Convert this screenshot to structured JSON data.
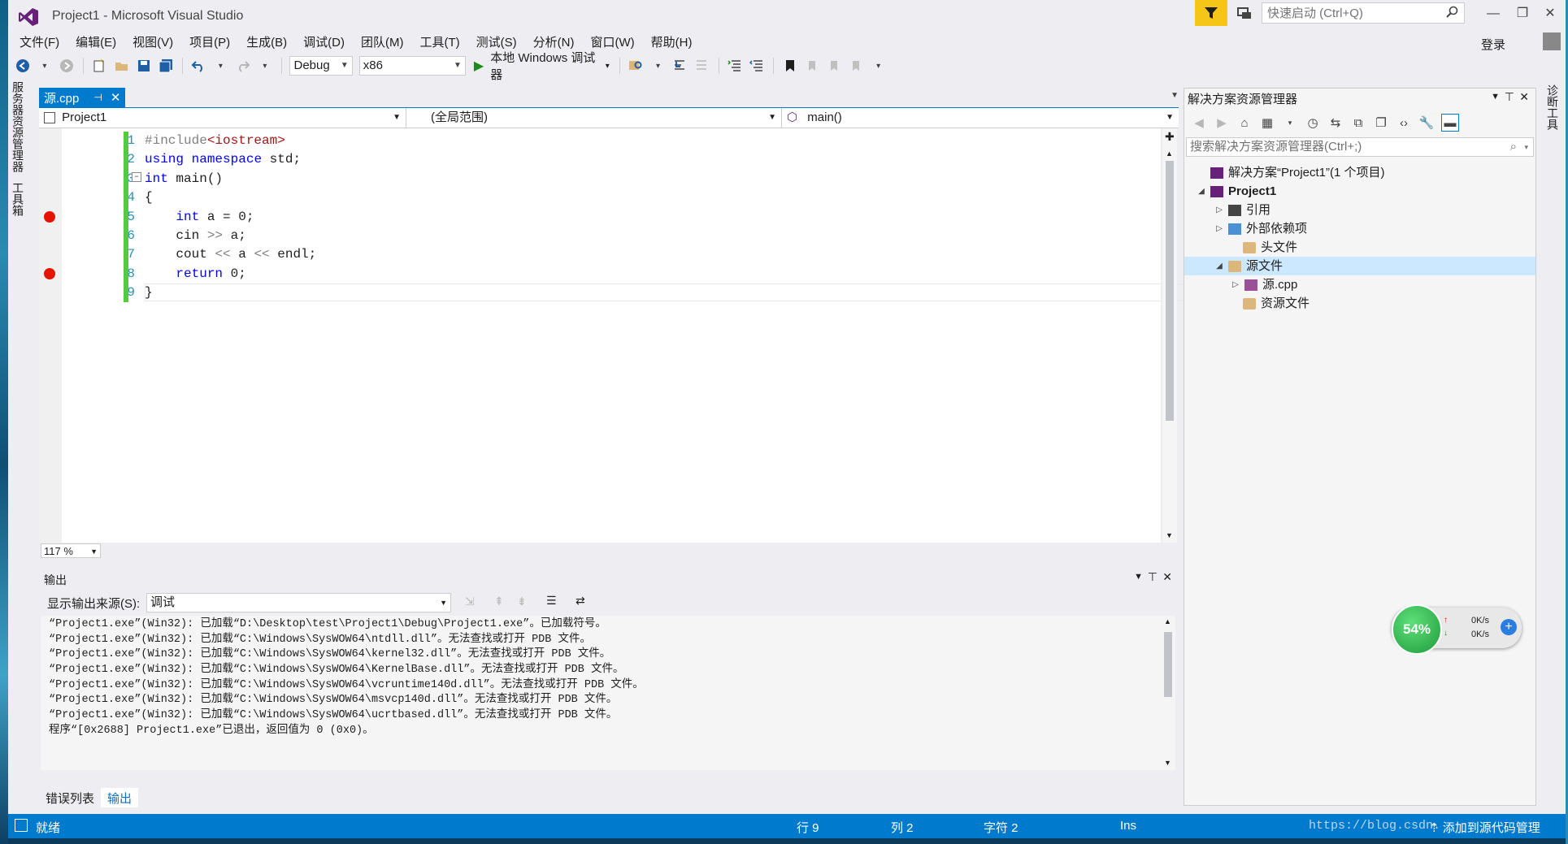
{
  "window": {
    "title": "Project1 - Microsoft Visual Studio",
    "quick_launch_placeholder": "快速启动 (Ctrl+Q)",
    "sign_in": "登录",
    "minimize": "—",
    "restore": "❐",
    "close": "✕"
  },
  "menu": [
    "文件(F)",
    "编辑(E)",
    "视图(V)",
    "项目(P)",
    "生成(B)",
    "调试(D)",
    "团队(M)",
    "工具(T)",
    "测试(S)",
    "分析(N)",
    "窗口(W)",
    "帮助(H)"
  ],
  "toolbar": {
    "configuration": "Debug",
    "platform": "x86",
    "run_label": "本地 Windows 调试器"
  },
  "left_vtabs": [
    "服务器资源管理器",
    "工具箱"
  ],
  "right_vtab": "诊断工具",
  "editor": {
    "tab_label": "源.cpp",
    "nav_project": "Project1",
    "nav_scope": "(全局范围)",
    "nav_member": "main()",
    "line_numbers": [
      "1",
      "2",
      "3",
      "4",
      "5",
      "6",
      "7",
      "8",
      "9"
    ],
    "code": [
      [
        {
          "t": "#include",
          "c": "pp"
        },
        {
          "t": "<iostream>",
          "c": "st"
        }
      ],
      [
        {
          "t": "using",
          "c": "kw"
        },
        {
          "t": " ",
          "c": ""
        },
        {
          "t": "namespace",
          "c": "kw"
        },
        {
          "t": " std;",
          "c": ""
        }
      ],
      [
        {
          "t": "int",
          "c": "kw"
        },
        {
          "t": " main()",
          "c": ""
        }
      ],
      [
        {
          "t": "{",
          "c": ""
        }
      ],
      [
        {
          "t": "    ",
          "c": ""
        },
        {
          "t": "int",
          "c": "kw"
        },
        {
          "t": " a = 0;",
          "c": ""
        }
      ],
      [
        {
          "t": "    cin ",
          "c": ""
        },
        {
          "t": ">>",
          "c": "op"
        },
        {
          "t": " a;",
          "c": ""
        }
      ],
      [
        {
          "t": "    cout ",
          "c": ""
        },
        {
          "t": "<<",
          "c": "op"
        },
        {
          "t": " a ",
          "c": ""
        },
        {
          "t": "<<",
          "c": "op"
        },
        {
          "t": " endl;",
          "c": ""
        }
      ],
      [
        {
          "t": "    ",
          "c": ""
        },
        {
          "t": "return",
          "c": "kw"
        },
        {
          "t": " 0;",
          "c": ""
        }
      ],
      [
        {
          "t": "}",
          "c": ""
        }
      ]
    ],
    "breakpoint_lines": [
      5,
      8
    ],
    "zoom": "117 %"
  },
  "output": {
    "title": "输出",
    "source_label": "显示输出来源(S):",
    "source_value": "调试",
    "lines": [
      "“Project1.exe”(Win32): 已加载“D:\\Desktop\\test\\Project1\\Debug\\Project1.exe”。已加载符号。",
      "“Project1.exe”(Win32): 已加载“C:\\Windows\\SysWOW64\\ntdll.dll”。无法查找或打开 PDB 文件。",
      "“Project1.exe”(Win32): 已加载“C:\\Windows\\SysWOW64\\kernel32.dll”。无法查找或打开 PDB 文件。",
      "“Project1.exe”(Win32): 已加载“C:\\Windows\\SysWOW64\\KernelBase.dll”。无法查找或打开 PDB 文件。",
      "“Project1.exe”(Win32): 已加载“C:\\Windows\\SysWOW64\\vcruntime140d.dll”。无法查找或打开 PDB 文件。",
      "“Project1.exe”(Win32): 已加载“C:\\Windows\\SysWOW64\\msvcp140d.dll”。无法查找或打开 PDB 文件。",
      "“Project1.exe”(Win32): 已加载“C:\\Windows\\SysWOW64\\ucrtbased.dll”。无法查找或打开 PDB 文件。",
      "程序“[0x2688] Project1.exe”已退出，返回值为 0 (0x0)。"
    ],
    "bottom_tabs": [
      "错误列表",
      "输出"
    ]
  },
  "solution_explorer": {
    "title": "解决方案资源管理器",
    "search_placeholder": "搜索解决方案资源管理器(Ctrl+;)",
    "items": [
      {
        "label": "解决方案“Project1”(1 个项目)",
        "expander": "",
        "icon": "solution-icon"
      },
      {
        "label": "Project1",
        "expander": "◢",
        "icon": "project-icon"
      },
      {
        "label": "引用",
        "expander": "▷",
        "icon": "references-icon"
      },
      {
        "label": "外部依赖项",
        "expander": "▷",
        "icon": "external-deps-icon"
      },
      {
        "label": "头文件",
        "expander": "",
        "icon": "folder-icon"
      },
      {
        "label": "源文件",
        "expander": "◢",
        "icon": "folder-icon"
      },
      {
        "label": "源.cpp",
        "expander": "▷",
        "icon": "cpp-file-icon"
      },
      {
        "label": "资源文件",
        "expander": "",
        "icon": "folder-icon"
      }
    ]
  },
  "net_widget": {
    "percent": "54%",
    "up_rate": "0K/s",
    "down_rate": "0K/s"
  },
  "status": {
    "ready": "就绪",
    "line": "行 9",
    "col": "列 2",
    "char": "字符 2",
    "mode": "Ins",
    "watermark": "https://blog.csdn.",
    "source_control": "添加到源代码管理"
  },
  "colors": {
    "accent": "#007acc",
    "breakpoint": "#e51400",
    "keyword": "#0000ff",
    "change_bar": "#57c93c"
  }
}
